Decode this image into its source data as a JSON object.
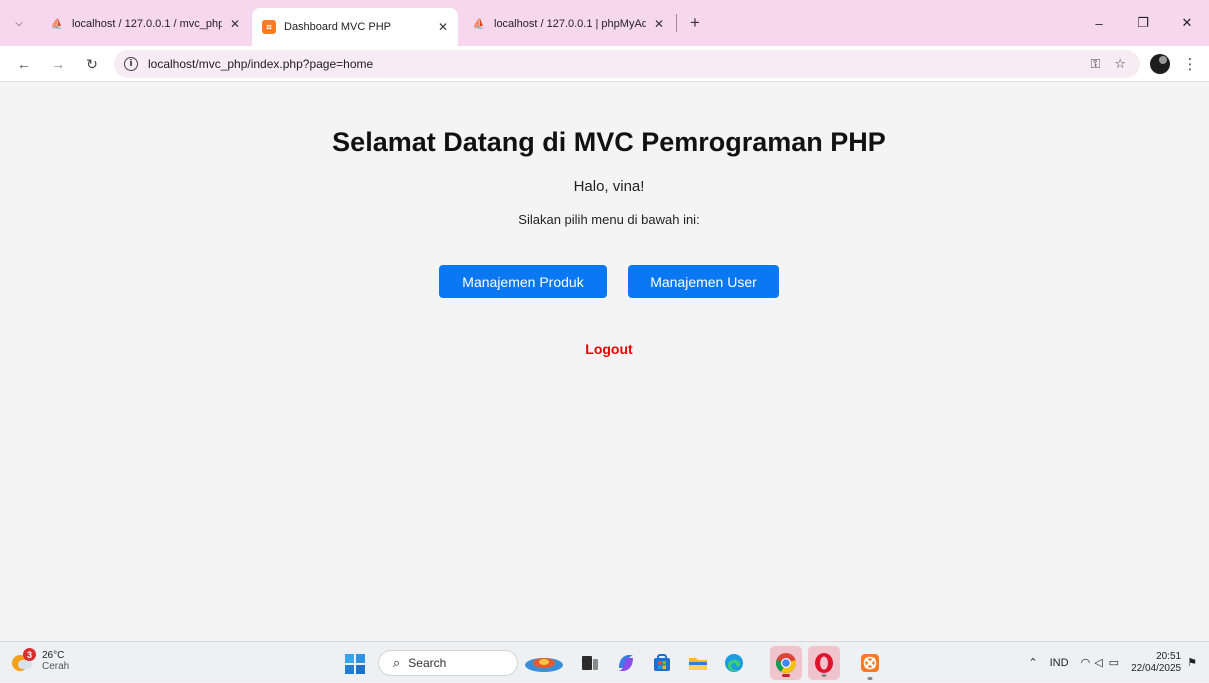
{
  "browser": {
    "tabs": [
      {
        "title": "localhost / 127.0.0.1 / mvc_php",
        "icon": "phpmyadmin-icon",
        "active": false
      },
      {
        "title": "Dashboard MVC PHP",
        "icon": "xampp-icon",
        "active": true
      },
      {
        "title": "localhost / 127.0.0.1 | phpMyAd",
        "icon": "phpmyadmin-icon",
        "active": false
      }
    ],
    "new_tab_glyph": "+",
    "url": "localhost/mvc_php/index.php?page=home"
  },
  "page": {
    "title": "Selamat Datang di MVC Pemrograman PHP",
    "greeting": "Halo, vina!",
    "instruction": "Silakan pilih menu di bawah ini:",
    "buttons": [
      {
        "label": "Manajemen Produk"
      },
      {
        "label": "Manajemen User"
      }
    ],
    "logout_label": "Logout",
    "colors": {
      "button_bg": "#0a78f2",
      "logout": "#e60000",
      "background": "#f4f4f4"
    }
  },
  "taskbar": {
    "weather": {
      "temp": "26°C",
      "condition": "Cerah",
      "badge": "3"
    },
    "search_placeholder": "Search",
    "tray": {
      "language": "IND",
      "time": "20:51",
      "date": "22/04/2025"
    }
  }
}
